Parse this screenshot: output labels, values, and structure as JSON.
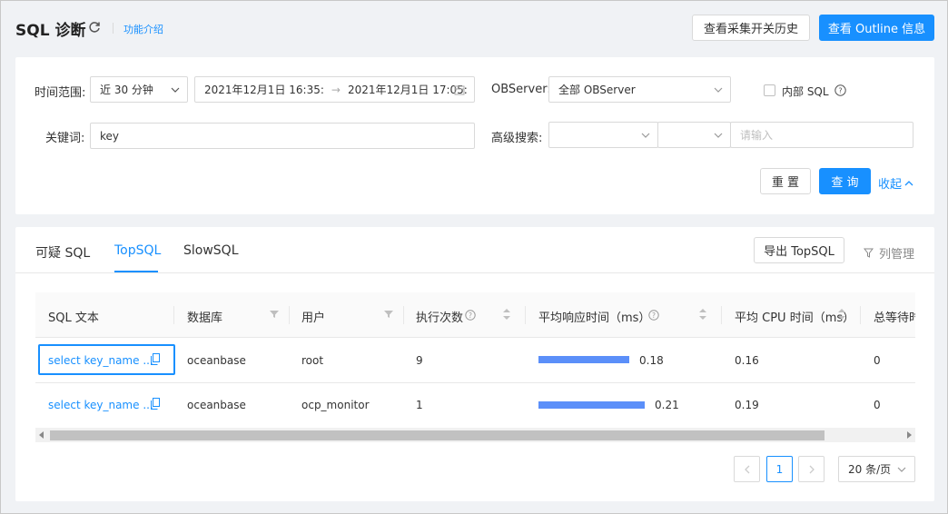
{
  "header": {
    "title": "SQL 诊断",
    "intro_link": "功能介绍",
    "history_button": "查看采集开关历史",
    "outline_button": "查看 Outline 信息"
  },
  "filters": {
    "time_range_label": "时间范围:",
    "time_range_value": "近 30 分钟",
    "start_time": "2021年12月1日 16:35:",
    "end_time": "2021年12月1日 17:05:",
    "range_separator": "→",
    "observer_label": "OBServer:",
    "observer_value": "全部 OBServer",
    "internal_sql_label": "内部 SQL",
    "keyword_label": "关键词:",
    "keyword_value": "key",
    "advanced_label": "高级搜索:",
    "advanced_input_placeholder": "请输入",
    "reset_button": "重 置",
    "query_button": "查 询",
    "collapse_link": "收起"
  },
  "tabs": [
    {
      "label": "可疑 SQL"
    },
    {
      "label": "TopSQL"
    },
    {
      "label": "SlowSQL"
    }
  ],
  "toolbar": {
    "export_button": "导出 TopSQL",
    "column_manage": "列管理"
  },
  "table": {
    "headers": [
      "SQL 文本",
      "数据库",
      "用户",
      "执行次数",
      "平均响应时间（ms）",
      "平均 CPU 时间（ms）",
      "总等待时"
    ],
    "rows": [
      {
        "sql": "select key_name ...",
        "db": "oceanbase",
        "user": "root",
        "exec_count": "9",
        "avg_resp": "0.18",
        "avg_resp_value": 0.18,
        "avg_cpu": "0.16",
        "wait": "0"
      },
      {
        "sql": "select key_name ...",
        "db": "oceanbase",
        "user": "ocp_monitor",
        "exec_count": "1",
        "avg_resp": "0.21",
        "avg_resp_value": 0.21,
        "avg_cpu": "0.19",
        "wait": "0"
      }
    ]
  },
  "pagination": {
    "current_page": "1",
    "page_size": "20 条/页"
  },
  "colors": {
    "primary": "#1890ff",
    "bar": "#5b8ff9"
  }
}
